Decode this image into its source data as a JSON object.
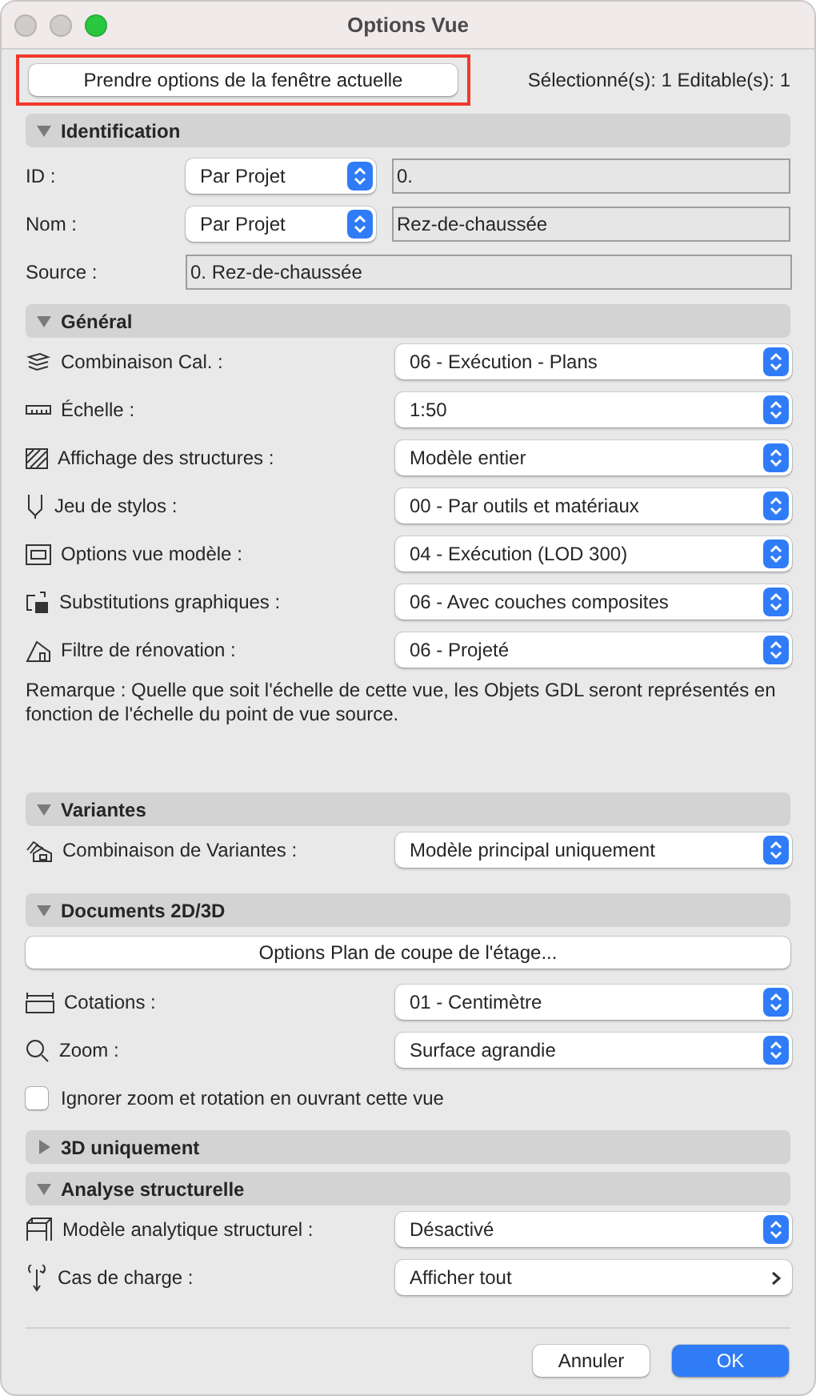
{
  "window": {
    "title": "Options Vue"
  },
  "top": {
    "button": {
      "label": "Prendre options de la fenêtre actuelle",
      "highlighted": true
    },
    "status": "Sélectionné(s): 1 Editable(s): 1"
  },
  "sections": [
    {
      "title": "Identification",
      "expanded": true,
      "rows": [
        {
          "kind": "pair",
          "label": "ID :",
          "select": "Par Projet",
          "value": "0."
        },
        {
          "kind": "pair",
          "label": "Nom :",
          "select": "Par Projet",
          "value": "Rez-de-chaussée"
        },
        {
          "kind": "field",
          "label": "Source :",
          "value": "0. Rez-de-chaussée"
        }
      ]
    },
    {
      "title": "Général",
      "expanded": true,
      "rows": [
        {
          "kind": "select",
          "label": "Combinaison Cal. :",
          "value": "06 - Exécution - Plans"
        },
        {
          "kind": "select",
          "label": "Échelle :",
          "value": "1:50"
        },
        {
          "kind": "select",
          "label": "Affichage des structures :",
          "value": "Modèle entier"
        },
        {
          "kind": "select",
          "label": "Jeu de stylos :",
          "value": "00 - Par outils et matériaux"
        },
        {
          "kind": "select",
          "label": "Options vue modèle :",
          "value": "04 - Exécution (LOD 300)"
        },
        {
          "kind": "select",
          "label": "Substitutions graphiques :",
          "value": "06 - Avec couches composites"
        },
        {
          "kind": "select",
          "label": "Filtre de rénovation :",
          "value": "06 - Projeté"
        },
        {
          "kind": "remark",
          "text": "Remarque : Quelle que soit l'échelle de cette vue, les Objets GDL seront représentés en fonction de l'échelle du point de vue source."
        }
      ]
    },
    {
      "title": "Variantes",
      "expanded": true,
      "rows": [
        {
          "kind": "select",
          "label": "Combinaison de Variantes :",
          "value": "Modèle principal uniquement"
        }
      ]
    },
    {
      "title": "Documents 2D/3D",
      "expanded": true,
      "rows": [
        {
          "kind": "button",
          "label": "Options Plan de coupe de l'étage..."
        },
        {
          "kind": "select",
          "label": "Cotations :",
          "value": "01 - Centimètre"
        },
        {
          "kind": "select",
          "label": "Zoom :",
          "value": "Surface agrandie"
        },
        {
          "kind": "checkbox",
          "label": "Ignorer zoom et rotation en ouvrant cette vue",
          "checked": false
        }
      ]
    },
    {
      "title": "3D uniquement",
      "expanded": false
    },
    {
      "title": "Analyse structurelle",
      "expanded": true,
      "rows": [
        {
          "kind": "select",
          "label": "Modèle analytique structurel :",
          "value": "Désactivé"
        },
        {
          "kind": "menu",
          "label": "Cas de charge :",
          "value": "Afficher tout"
        }
      ]
    }
  ],
  "footer": {
    "buttons": [
      {
        "label": "Annuler",
        "primary": false
      },
      {
        "label": "OK",
        "primary": true
      }
    ]
  }
}
